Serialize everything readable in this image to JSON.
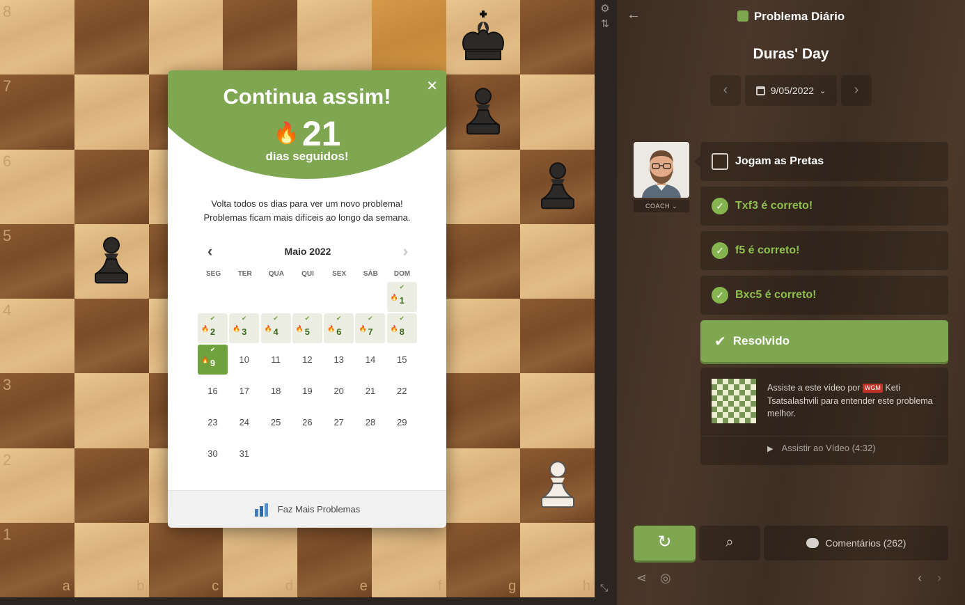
{
  "board": {
    "ranks": [
      "8",
      "7",
      "6",
      "5",
      "4",
      "3",
      "2",
      "1"
    ],
    "files": [
      "a",
      "b",
      "c",
      "d",
      "e",
      "f",
      "g",
      "h"
    ]
  },
  "modal": {
    "title": "Continua assim!",
    "streak_count": "21",
    "streak_label": "dias seguidos!",
    "desc_line1": "Volta todos os dias para ver um novo problema!",
    "desc_line2": "Problemas ficam mais difíceis ao longo da semana.",
    "calendar": {
      "month": "Maio 2022",
      "weekdays": [
        "SEG",
        "TER",
        "QUA",
        "QUI",
        "SEX",
        "SÁB",
        "DOM"
      ]
    },
    "footer_label": "Faz Mais Problemas"
  },
  "sidebar": {
    "title": "Problema Diário",
    "puzzle_name": "Duras' Day",
    "date": "9/05/2022",
    "coach_label": "COACH",
    "side_to_move": "Jogam as Pretas",
    "moves": [
      "Txf3 é correto!",
      "f5 é correto!",
      "Bxc5 é correto!"
    ],
    "solved_label": "Resolvido",
    "video_text_before": "Assiste a este vídeo por",
    "video_title_badge": "WGM",
    "video_text_after": "Keti Tsatsalashvili para entender este problema melhor.",
    "video_link": "Assistir ao Vídeo (4:32)",
    "comments_label": "Comentários",
    "comments_count": "(262)"
  },
  "colors": {
    "accent_green": "#7fa650",
    "correct_green": "#8fbf4f",
    "flame": "#f4a53a",
    "wgm_badge": "#c3332a"
  }
}
